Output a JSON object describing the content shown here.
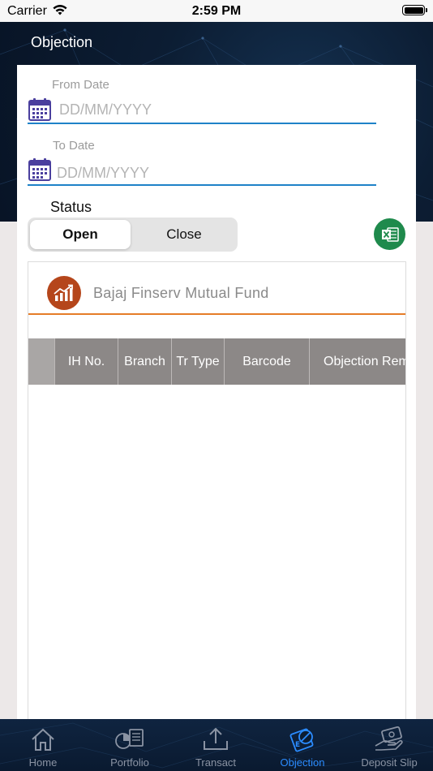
{
  "status_bar": {
    "carrier": "Carrier",
    "time": "2:59 PM"
  },
  "header": {
    "title": "Objection"
  },
  "form": {
    "from_date": {
      "label": "From Date",
      "placeholder": "DD/MM/YYYY",
      "value": ""
    },
    "to_date": {
      "label": "To Date",
      "placeholder": "DD/MM/YYYY",
      "value": ""
    },
    "status": {
      "label": "Status",
      "options": [
        "Open",
        "Close"
      ],
      "selected": "Open"
    }
  },
  "fund": {
    "name": "Bajaj Finserv Mutual Fund"
  },
  "table": {
    "columns": [
      "IH No.",
      "Branch",
      "Tr Type",
      "Barcode",
      "Objection Remarks"
    ],
    "rows": []
  },
  "tab_bar": {
    "items": [
      {
        "label": "Home",
        "icon": "home-icon",
        "active": false
      },
      {
        "label": "Portfolio",
        "icon": "portfolio-icon",
        "active": false
      },
      {
        "label": "Transact",
        "icon": "transact-icon",
        "active": false
      },
      {
        "label": "Objection",
        "icon": "objection-icon",
        "active": true
      },
      {
        "label": "Deposit Slip",
        "icon": "deposit-slip-icon",
        "active": false
      }
    ]
  },
  "colors": {
    "accent_blue": "#1e82c8",
    "fund_orange": "#e57c28",
    "tab_active": "#2b8cff",
    "excel_green": "#1f8a4c"
  }
}
